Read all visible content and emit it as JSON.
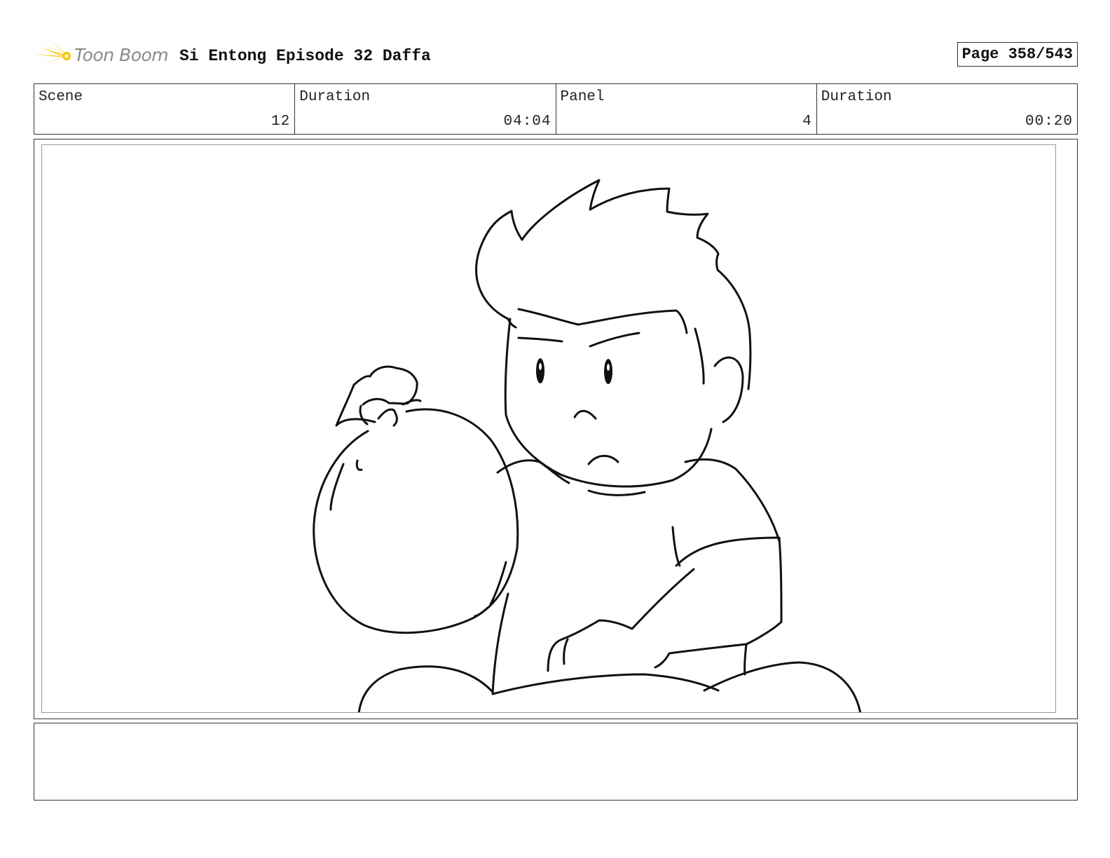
{
  "header": {
    "logo_text": "Toon Boom",
    "logo_accent": "#f5c400",
    "title": "Si Entong Episode 32 Daffa",
    "page": "Page 358/543"
  },
  "info": [
    {
      "label": "Scene",
      "value": "12"
    },
    {
      "label": "Duration",
      "value": "04:04"
    },
    {
      "label": "Panel",
      "value": "4"
    },
    {
      "label": "Duration",
      "value": "00:20"
    }
  ],
  "notes": ""
}
